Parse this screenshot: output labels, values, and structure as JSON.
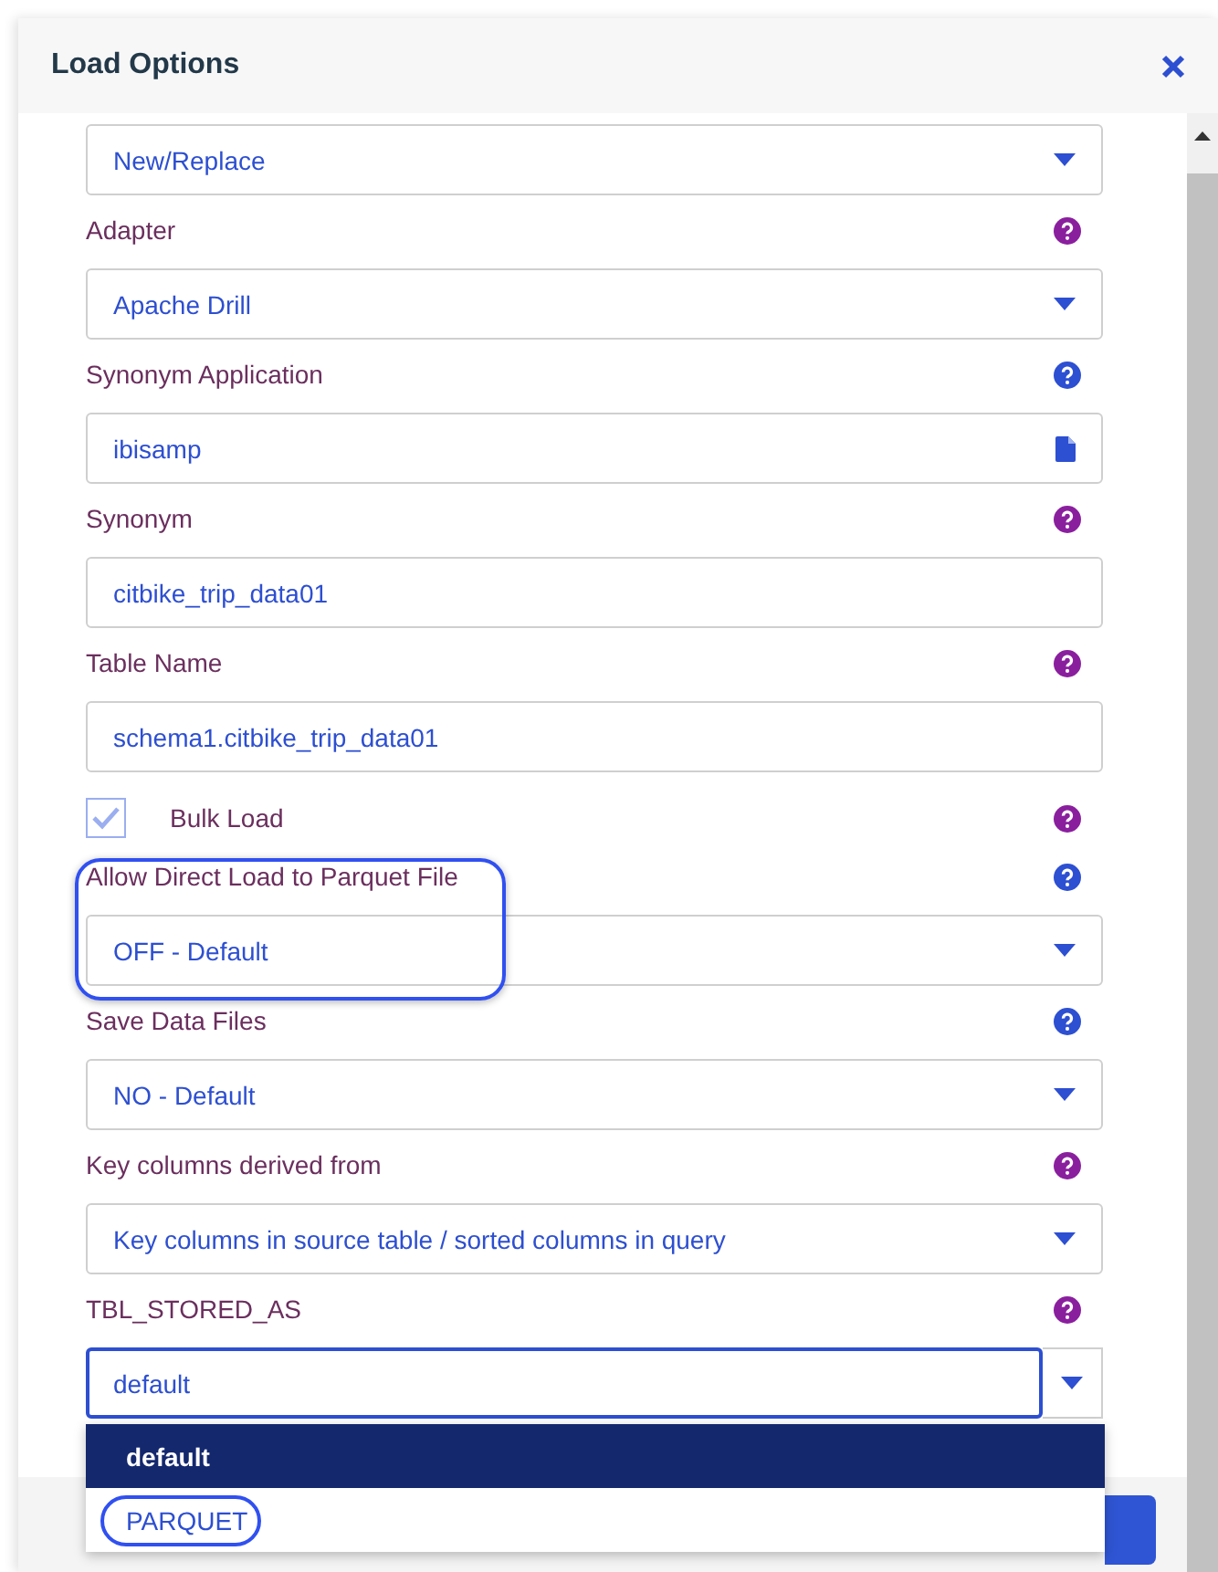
{
  "dialog": {
    "title": "Load Options"
  },
  "fields": [
    {
      "kind": "select",
      "value": "New/Replace"
    },
    {
      "kind": "select",
      "label": "Adapter",
      "color": "#8a1f9e",
      "value": "Apache Drill"
    },
    {
      "kind": "file",
      "label": "Synonym Application",
      "color": "#2d4fd1",
      "value": "ibisamp"
    },
    {
      "kind": "text",
      "label": "Synonym",
      "color": "#8a1f9e",
      "value": "citbike_trip_data01"
    },
    {
      "kind": "text",
      "label": "Table Name",
      "color": "#8a1f9e",
      "value": "schema1.citbike_trip_data01"
    },
    {
      "kind": "checkbox",
      "label": "Bulk Load",
      "color": "#8a1f9e",
      "checked": true
    },
    {
      "kind": "select",
      "label": "Allow Direct Load to Parquet File",
      "color": "#2d4fd1",
      "value": "OFF - Default",
      "highlighted": true
    },
    {
      "kind": "select",
      "label": "Save Data Files",
      "color": "#2d4fd1",
      "value": "NO - Default"
    },
    {
      "kind": "select",
      "label": "Key columns derived from",
      "color": "#8a1f9e",
      "value": "Key columns in source table / sorted columns in query"
    },
    {
      "kind": "combo",
      "label": "TBL_STORED_AS",
      "color": "#8a1f9e",
      "value": "default",
      "options": [
        {
          "label": "default",
          "selected": true
        },
        {
          "label": "PARQUET",
          "selected": false,
          "highlighted": true
        }
      ]
    }
  ]
}
